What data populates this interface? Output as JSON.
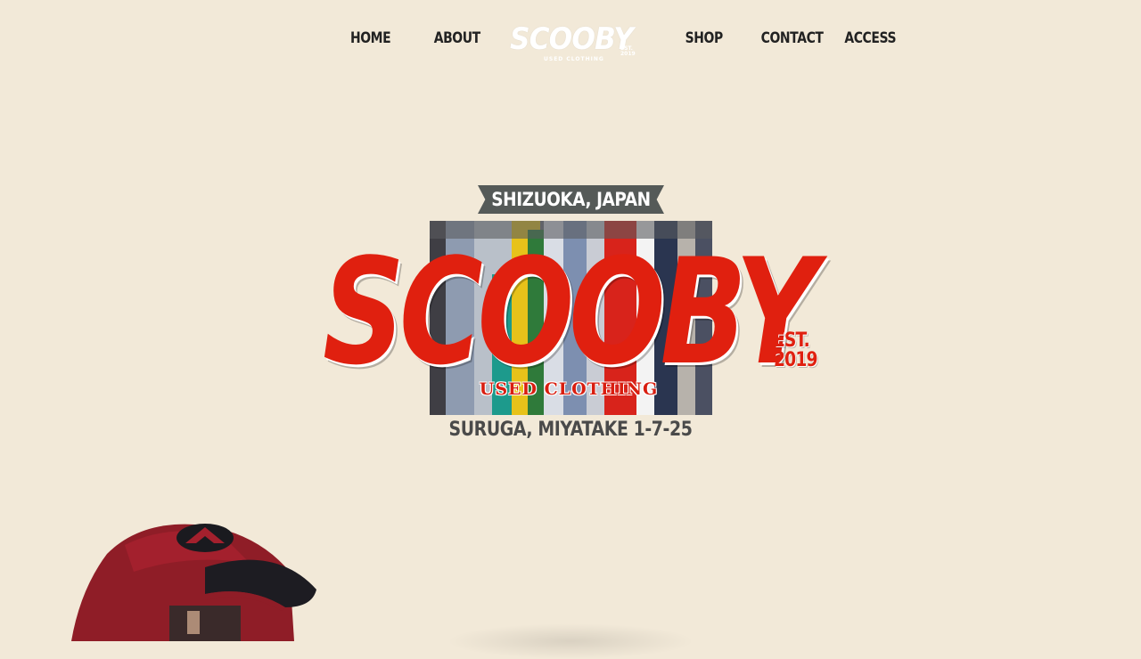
{
  "nav": {
    "items": [
      {
        "label": "HOME"
      },
      {
        "label": "ABOUT"
      },
      {
        "label": "SHOP"
      },
      {
        "label": "CONTACT"
      },
      {
        "label": "ACCESS"
      }
    ],
    "logo": {
      "mark": "SCOOBY",
      "est": "EST. 2019",
      "sub": "USED CLOTHING"
    }
  },
  "hero": {
    "location": "SHIZUOKA, JAPAN",
    "brand": "SCOOBY",
    "est_line1": "EST.",
    "est_line2": "2019",
    "tagline": "USED CLOTHING",
    "address": "SURUGA, MIYATAKE 1-7-25"
  },
  "colors": {
    "background": "#f2e9d8",
    "brand_red": "#e0200f",
    "ribbon": "#555a58",
    "nav_text": "#222222"
  }
}
